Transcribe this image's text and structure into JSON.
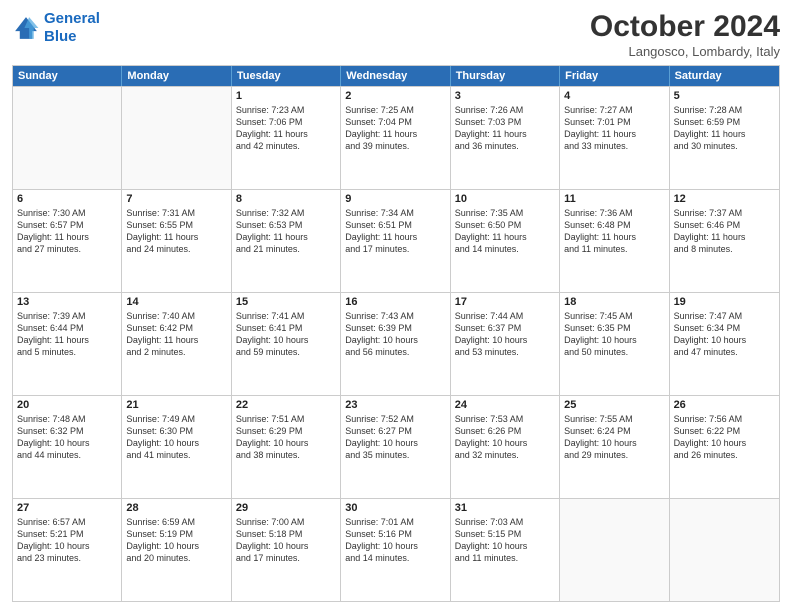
{
  "header": {
    "logo_line1": "General",
    "logo_line2": "Blue",
    "month_title": "October 2024",
    "location": "Langosco, Lombardy, Italy"
  },
  "days_of_week": [
    "Sunday",
    "Monday",
    "Tuesday",
    "Wednesday",
    "Thursday",
    "Friday",
    "Saturday"
  ],
  "rows": [
    [
      {
        "day": "",
        "lines": [],
        "empty": true
      },
      {
        "day": "",
        "lines": [],
        "empty": true
      },
      {
        "day": "1",
        "lines": [
          "Sunrise: 7:23 AM",
          "Sunset: 7:06 PM",
          "Daylight: 11 hours",
          "and 42 minutes."
        ],
        "empty": false
      },
      {
        "day": "2",
        "lines": [
          "Sunrise: 7:25 AM",
          "Sunset: 7:04 PM",
          "Daylight: 11 hours",
          "and 39 minutes."
        ],
        "empty": false
      },
      {
        "day": "3",
        "lines": [
          "Sunrise: 7:26 AM",
          "Sunset: 7:03 PM",
          "Daylight: 11 hours",
          "and 36 minutes."
        ],
        "empty": false
      },
      {
        "day": "4",
        "lines": [
          "Sunrise: 7:27 AM",
          "Sunset: 7:01 PM",
          "Daylight: 11 hours",
          "and 33 minutes."
        ],
        "empty": false
      },
      {
        "day": "5",
        "lines": [
          "Sunrise: 7:28 AM",
          "Sunset: 6:59 PM",
          "Daylight: 11 hours",
          "and 30 minutes."
        ],
        "empty": false
      }
    ],
    [
      {
        "day": "6",
        "lines": [
          "Sunrise: 7:30 AM",
          "Sunset: 6:57 PM",
          "Daylight: 11 hours",
          "and 27 minutes."
        ],
        "empty": false
      },
      {
        "day": "7",
        "lines": [
          "Sunrise: 7:31 AM",
          "Sunset: 6:55 PM",
          "Daylight: 11 hours",
          "and 24 minutes."
        ],
        "empty": false
      },
      {
        "day": "8",
        "lines": [
          "Sunrise: 7:32 AM",
          "Sunset: 6:53 PM",
          "Daylight: 11 hours",
          "and 21 minutes."
        ],
        "empty": false
      },
      {
        "day": "9",
        "lines": [
          "Sunrise: 7:34 AM",
          "Sunset: 6:51 PM",
          "Daylight: 11 hours",
          "and 17 minutes."
        ],
        "empty": false
      },
      {
        "day": "10",
        "lines": [
          "Sunrise: 7:35 AM",
          "Sunset: 6:50 PM",
          "Daylight: 11 hours",
          "and 14 minutes."
        ],
        "empty": false
      },
      {
        "day": "11",
        "lines": [
          "Sunrise: 7:36 AM",
          "Sunset: 6:48 PM",
          "Daylight: 11 hours",
          "and 11 minutes."
        ],
        "empty": false
      },
      {
        "day": "12",
        "lines": [
          "Sunrise: 7:37 AM",
          "Sunset: 6:46 PM",
          "Daylight: 11 hours",
          "and 8 minutes."
        ],
        "empty": false
      }
    ],
    [
      {
        "day": "13",
        "lines": [
          "Sunrise: 7:39 AM",
          "Sunset: 6:44 PM",
          "Daylight: 11 hours",
          "and 5 minutes."
        ],
        "empty": false
      },
      {
        "day": "14",
        "lines": [
          "Sunrise: 7:40 AM",
          "Sunset: 6:42 PM",
          "Daylight: 11 hours",
          "and 2 minutes."
        ],
        "empty": false
      },
      {
        "day": "15",
        "lines": [
          "Sunrise: 7:41 AM",
          "Sunset: 6:41 PM",
          "Daylight: 10 hours",
          "and 59 minutes."
        ],
        "empty": false
      },
      {
        "day": "16",
        "lines": [
          "Sunrise: 7:43 AM",
          "Sunset: 6:39 PM",
          "Daylight: 10 hours",
          "and 56 minutes."
        ],
        "empty": false
      },
      {
        "day": "17",
        "lines": [
          "Sunrise: 7:44 AM",
          "Sunset: 6:37 PM",
          "Daylight: 10 hours",
          "and 53 minutes."
        ],
        "empty": false
      },
      {
        "day": "18",
        "lines": [
          "Sunrise: 7:45 AM",
          "Sunset: 6:35 PM",
          "Daylight: 10 hours",
          "and 50 minutes."
        ],
        "empty": false
      },
      {
        "day": "19",
        "lines": [
          "Sunrise: 7:47 AM",
          "Sunset: 6:34 PM",
          "Daylight: 10 hours",
          "and 47 minutes."
        ],
        "empty": false
      }
    ],
    [
      {
        "day": "20",
        "lines": [
          "Sunrise: 7:48 AM",
          "Sunset: 6:32 PM",
          "Daylight: 10 hours",
          "and 44 minutes."
        ],
        "empty": false
      },
      {
        "day": "21",
        "lines": [
          "Sunrise: 7:49 AM",
          "Sunset: 6:30 PM",
          "Daylight: 10 hours",
          "and 41 minutes."
        ],
        "empty": false
      },
      {
        "day": "22",
        "lines": [
          "Sunrise: 7:51 AM",
          "Sunset: 6:29 PM",
          "Daylight: 10 hours",
          "and 38 minutes."
        ],
        "empty": false
      },
      {
        "day": "23",
        "lines": [
          "Sunrise: 7:52 AM",
          "Sunset: 6:27 PM",
          "Daylight: 10 hours",
          "and 35 minutes."
        ],
        "empty": false
      },
      {
        "day": "24",
        "lines": [
          "Sunrise: 7:53 AM",
          "Sunset: 6:26 PM",
          "Daylight: 10 hours",
          "and 32 minutes."
        ],
        "empty": false
      },
      {
        "day": "25",
        "lines": [
          "Sunrise: 7:55 AM",
          "Sunset: 6:24 PM",
          "Daylight: 10 hours",
          "and 29 minutes."
        ],
        "empty": false
      },
      {
        "day": "26",
        "lines": [
          "Sunrise: 7:56 AM",
          "Sunset: 6:22 PM",
          "Daylight: 10 hours",
          "and 26 minutes."
        ],
        "empty": false
      }
    ],
    [
      {
        "day": "27",
        "lines": [
          "Sunrise: 6:57 AM",
          "Sunset: 5:21 PM",
          "Daylight: 10 hours",
          "and 23 minutes."
        ],
        "empty": false
      },
      {
        "day": "28",
        "lines": [
          "Sunrise: 6:59 AM",
          "Sunset: 5:19 PM",
          "Daylight: 10 hours",
          "and 20 minutes."
        ],
        "empty": false
      },
      {
        "day": "29",
        "lines": [
          "Sunrise: 7:00 AM",
          "Sunset: 5:18 PM",
          "Daylight: 10 hours",
          "and 17 minutes."
        ],
        "empty": false
      },
      {
        "day": "30",
        "lines": [
          "Sunrise: 7:01 AM",
          "Sunset: 5:16 PM",
          "Daylight: 10 hours",
          "and 14 minutes."
        ],
        "empty": false
      },
      {
        "day": "31",
        "lines": [
          "Sunrise: 7:03 AM",
          "Sunset: 5:15 PM",
          "Daylight: 10 hours",
          "and 11 minutes."
        ],
        "empty": false
      },
      {
        "day": "",
        "lines": [],
        "empty": true
      },
      {
        "day": "",
        "lines": [],
        "empty": true
      }
    ]
  ]
}
